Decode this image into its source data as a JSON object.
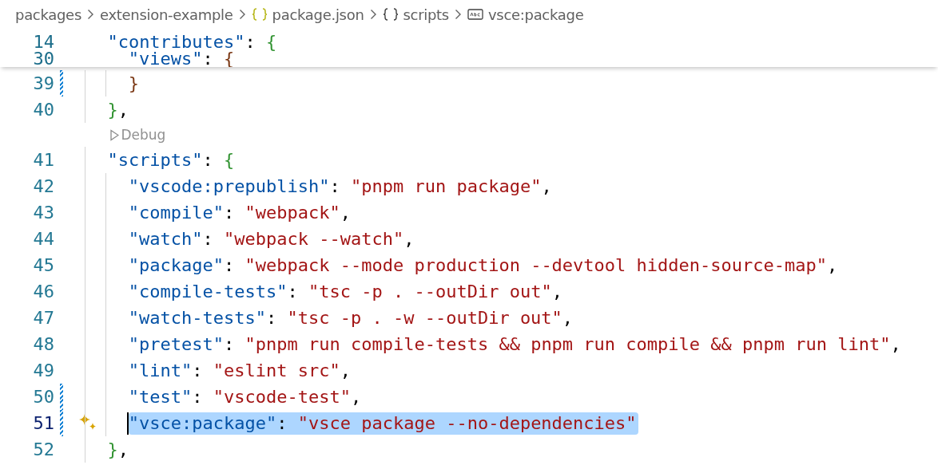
{
  "breadcrumb": [
    {
      "kind": "folder",
      "label": "packages"
    },
    {
      "kind": "folder",
      "label": "extension-example"
    },
    {
      "kind": "json-file",
      "label": "package.json"
    },
    {
      "kind": "object",
      "label": "scripts"
    },
    {
      "kind": "string",
      "label": "vsce:package"
    }
  ],
  "sticky_lines": [
    {
      "number": "14",
      "tokens": [
        {
          "kind": "key",
          "text": "  \"contributes\""
        },
        {
          "kind": "punct",
          "text": ": "
        },
        {
          "kind": "brace-a",
          "text": "{"
        }
      ]
    },
    {
      "number": "30",
      "tokens": [
        {
          "kind": "key",
          "text": "    \"views\""
        },
        {
          "kind": "punct",
          "text": ": "
        },
        {
          "kind": "brace-b",
          "text": "{"
        }
      ]
    }
  ],
  "lines": [
    {
      "kind": "code",
      "number": "39",
      "modified": true,
      "sparkle": false,
      "cursor": false,
      "selected": false,
      "tokens": [
        {
          "kind": "brace-b",
          "text": "    }"
        }
      ]
    },
    {
      "kind": "code",
      "number": "40",
      "modified": false,
      "sparkle": false,
      "cursor": false,
      "selected": false,
      "tokens": [
        {
          "kind": "brace-a",
          "text": "  }"
        },
        {
          "kind": "punct",
          "text": ","
        }
      ]
    },
    {
      "kind": "codelens",
      "label": "Debug"
    },
    {
      "kind": "code",
      "number": "41",
      "modified": false,
      "sparkle": false,
      "cursor": false,
      "selected": false,
      "tokens": [
        {
          "kind": "key",
          "text": "  \"scripts\""
        },
        {
          "kind": "punct",
          "text": ": "
        },
        {
          "kind": "brace-a",
          "text": "{"
        }
      ]
    },
    {
      "kind": "code",
      "number": "42",
      "modified": false,
      "sparkle": false,
      "cursor": false,
      "selected": false,
      "tokens": [
        {
          "kind": "key",
          "text": "    \"vscode:prepublish\""
        },
        {
          "kind": "punct",
          "text": ": "
        },
        {
          "kind": "string",
          "text": "\"pnpm run package\""
        },
        {
          "kind": "punct",
          "text": ","
        }
      ]
    },
    {
      "kind": "code",
      "number": "43",
      "modified": false,
      "sparkle": false,
      "cursor": false,
      "selected": false,
      "tokens": [
        {
          "kind": "key",
          "text": "    \"compile\""
        },
        {
          "kind": "punct",
          "text": ": "
        },
        {
          "kind": "string",
          "text": "\"webpack\""
        },
        {
          "kind": "punct",
          "text": ","
        }
      ]
    },
    {
      "kind": "code",
      "number": "44",
      "modified": false,
      "sparkle": false,
      "cursor": false,
      "selected": false,
      "tokens": [
        {
          "kind": "key",
          "text": "    \"watch\""
        },
        {
          "kind": "punct",
          "text": ": "
        },
        {
          "kind": "string",
          "text": "\"webpack --watch\""
        },
        {
          "kind": "punct",
          "text": ","
        }
      ]
    },
    {
      "kind": "code",
      "number": "45",
      "modified": false,
      "sparkle": false,
      "cursor": false,
      "selected": false,
      "tokens": [
        {
          "kind": "key",
          "text": "    \"package\""
        },
        {
          "kind": "punct",
          "text": ": "
        },
        {
          "kind": "string",
          "text": "\"webpack --mode production --devtool hidden-source-map\""
        },
        {
          "kind": "punct",
          "text": ","
        }
      ]
    },
    {
      "kind": "code",
      "number": "46",
      "modified": false,
      "sparkle": false,
      "cursor": false,
      "selected": false,
      "tokens": [
        {
          "kind": "key",
          "text": "    \"compile-tests\""
        },
        {
          "kind": "punct",
          "text": ": "
        },
        {
          "kind": "string",
          "text": "\"tsc -p . --outDir out\""
        },
        {
          "kind": "punct",
          "text": ","
        }
      ]
    },
    {
      "kind": "code",
      "number": "47",
      "modified": false,
      "sparkle": false,
      "cursor": false,
      "selected": false,
      "tokens": [
        {
          "kind": "key",
          "text": "    \"watch-tests\""
        },
        {
          "kind": "punct",
          "text": ": "
        },
        {
          "kind": "string",
          "text": "\"tsc -p . -w --outDir out\""
        },
        {
          "kind": "punct",
          "text": ","
        }
      ]
    },
    {
      "kind": "code",
      "number": "48",
      "modified": false,
      "sparkle": false,
      "cursor": false,
      "selected": false,
      "tokens": [
        {
          "kind": "key",
          "text": "    \"pretest\""
        },
        {
          "kind": "punct",
          "text": ": "
        },
        {
          "kind": "string",
          "text": "\"pnpm run compile-tests && pnpm run compile && pnpm run lint\""
        },
        {
          "kind": "punct",
          "text": ","
        }
      ]
    },
    {
      "kind": "code",
      "number": "49",
      "modified": false,
      "sparkle": false,
      "cursor": false,
      "selected": false,
      "tokens": [
        {
          "kind": "key",
          "text": "    \"lint\""
        },
        {
          "kind": "punct",
          "text": ": "
        },
        {
          "kind": "string",
          "text": "\"eslint src\""
        },
        {
          "kind": "punct",
          "text": ","
        }
      ]
    },
    {
      "kind": "code",
      "number": "50",
      "modified": true,
      "sparkle": false,
      "cursor": false,
      "selected": false,
      "tokens": [
        {
          "kind": "key",
          "text": "    \"test\""
        },
        {
          "kind": "punct",
          "text": ": "
        },
        {
          "kind": "string",
          "text": "\"vscode-test\""
        },
        {
          "kind": "punct",
          "text": ","
        }
      ]
    },
    {
      "kind": "code",
      "number": "51",
      "modified": true,
      "sparkle": true,
      "cursor": true,
      "selected": true,
      "tokens": [
        {
          "kind": "key",
          "text": "    \"vsce:package\""
        },
        {
          "kind": "punct",
          "text": ": "
        },
        {
          "kind": "string",
          "text": "\"vsce package --no-dependencies\""
        }
      ]
    },
    {
      "kind": "code",
      "number": "52",
      "modified": false,
      "sparkle": false,
      "cursor": false,
      "selected": false,
      "tokens": [
        {
          "kind": "brace-a",
          "text": "  }"
        },
        {
          "kind": "punct",
          "text": ","
        }
      ]
    }
  ]
}
